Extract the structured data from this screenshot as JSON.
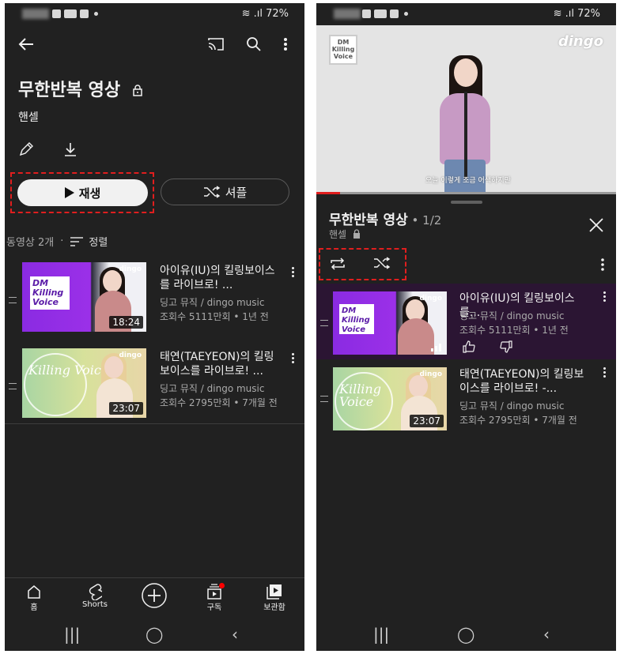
{
  "left_screen": {
    "status": {
      "battery": "72%"
    },
    "playlist": {
      "title": "무한반복 영상",
      "owner": "핸셀",
      "play_label": "재생",
      "shuffle_label": "셔플",
      "video_count": "동영상 2개",
      "sort_label": "정렬"
    },
    "videos": [
      {
        "title": "아이유(IU)의 킬링보이스를 라이브로! ...",
        "channel": "딩고 뮤직 / dingo music",
        "views": "조회수 5111만회 • 1년 전",
        "duration": "18:24",
        "thumb_logo": "dingo",
        "thumb_text": "DM Killing Voice"
      },
      {
        "title": "태연(TAEYEON)의 킬링보이스를 라이브로! ...",
        "channel": "딩고 뮤직 / dingo music",
        "views": "조회수 2795만회 • 7개월 전",
        "duration": "23:07",
        "thumb_logo": "dingo",
        "thumb_text": "Killing Voice"
      }
    ],
    "bottom_nav": [
      {
        "label": "홈",
        "icon": "home-icon"
      },
      {
        "label": "Shorts",
        "icon": "shorts-icon"
      },
      {
        "label": "",
        "icon": "create-icon"
      },
      {
        "label": "구독",
        "icon": "subscriptions-icon"
      },
      {
        "label": "보관함",
        "icon": "library-icon"
      }
    ]
  },
  "right_screen": {
    "status": {
      "battery": "72%"
    },
    "player": {
      "brand": "dingo",
      "caption": "오늘 이렇게 조금 어색하지만"
    },
    "queue": {
      "title": "무한반복 영상",
      "count": " • 1/2",
      "owner": "핸셀",
      "items": [
        {
          "title": "아이유(IU)의 킬링보이스를...",
          "channel": "딩고 뮤직 / dingo music",
          "views": "조회수 5111만회 • 1년 전"
        },
        {
          "title": "태연(TAEYEON)의 킬링보이스를 라이브로! -...",
          "channel": "딩고 뮤직 / dingo music",
          "views": "조회수 2795만회 • 7개월 전",
          "duration": "23:07"
        }
      ]
    }
  },
  "colors": {
    "background": "#212121",
    "highlight": "#e01e1e",
    "active_row": "#2b1533",
    "accent_purple": "#8a2be2"
  }
}
